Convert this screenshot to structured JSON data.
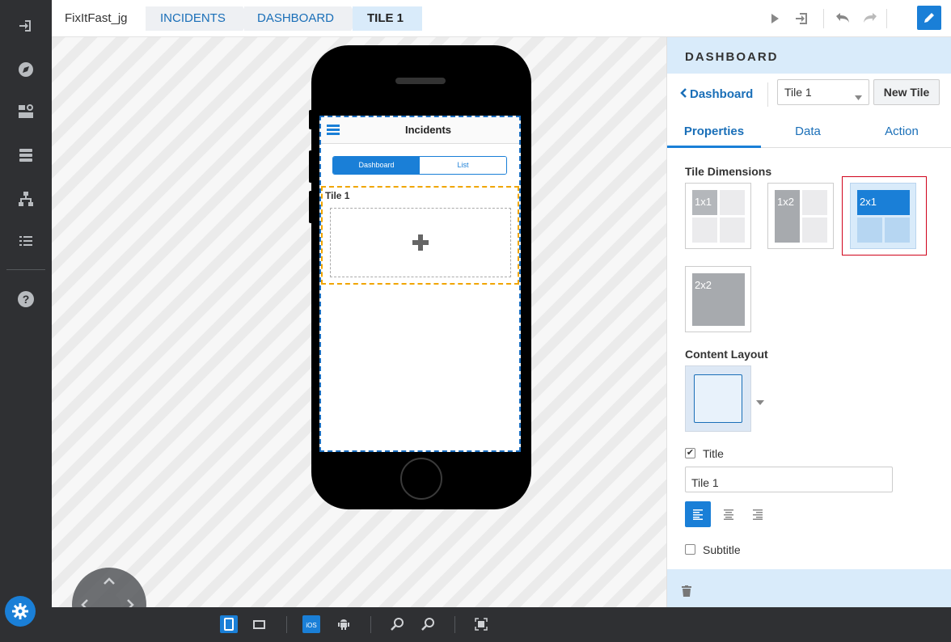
{
  "breadcrumb": {
    "app": "FixItFast_jg",
    "items": [
      "INCIDENTS",
      "DASHBOARD",
      "TILE 1"
    ]
  },
  "rail_icons": [
    "sign-in-icon",
    "compass-icon",
    "ui-components-icon",
    "database-icon",
    "sitemap-icon",
    "list-icon",
    "help-icon",
    "settings-gear-icon"
  ],
  "toolbar_icons": [
    "play-icon",
    "export-icon",
    "undo-icon",
    "redo-icon",
    "edit-pencil-icon"
  ],
  "phone": {
    "app_title": "Incidents",
    "segments": [
      "Dashboard",
      "List"
    ],
    "active_segment": "Dashboard",
    "tile_label": "Tile 1"
  },
  "bottom_toolbar_icons": [
    "phone-portrait-icon",
    "tablet-landscape-icon",
    "ios-icon",
    "android-icon",
    "zoom-in-icon",
    "zoom-out-icon",
    "fit-screen-icon"
  ],
  "panel": {
    "header": "DASHBOARD",
    "back_label": "Dashboard",
    "tile_select": "Tile 1",
    "new_tile": "New Tile",
    "tabs": [
      "Properties",
      "Data",
      "Action"
    ],
    "active_tab": "Properties",
    "tile_dimensions_label": "Tile Dimensions",
    "dimensions": [
      "1x1",
      "1x2",
      "2x1",
      "2x2"
    ],
    "selected_dimension": "2x1",
    "content_layout_label": "Content Layout",
    "title_checkbox_label": "Title",
    "title_checked": true,
    "title_value": "Tile 1",
    "subtitle_checkbox_label": "Subtitle",
    "subtitle_checked": false
  },
  "colors": {
    "accent": "#1a7fd7",
    "rail": "#2f3033",
    "panel_header": "#d9ebfa",
    "selection_outline": "#d0021b",
    "tile_outline": "#f0a500"
  }
}
